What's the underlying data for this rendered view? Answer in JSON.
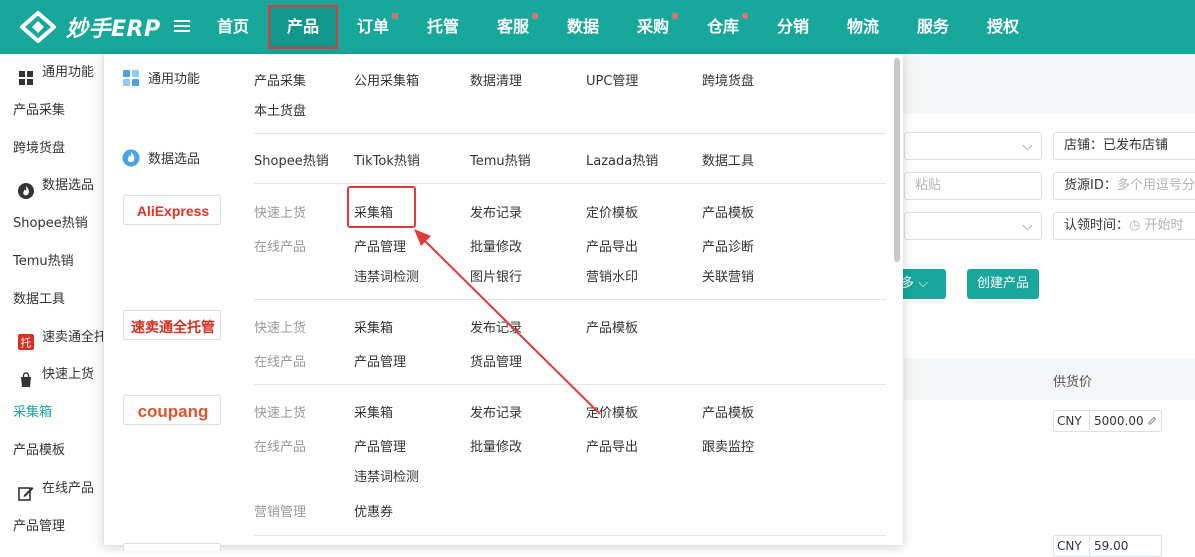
{
  "app": {
    "name": "妙手ERP"
  },
  "nav": [
    {
      "label": "首页",
      "dot": false
    },
    {
      "label": "产品",
      "dot": false,
      "active": true
    },
    {
      "label": "订单",
      "dot": true
    },
    {
      "label": "托管",
      "dot": false
    },
    {
      "label": "客服",
      "dot": true
    },
    {
      "label": "数据",
      "dot": false
    },
    {
      "label": "采购",
      "dot": true
    },
    {
      "label": "仓库",
      "dot": true
    },
    {
      "label": "分销",
      "dot": false
    },
    {
      "label": "物流",
      "dot": false
    },
    {
      "label": "服务",
      "dot": false
    },
    {
      "label": "授权",
      "dot": false
    }
  ],
  "sidebar": {
    "items": [
      {
        "label": "通用功能",
        "group": true,
        "icon": "grid-icon"
      },
      {
        "label": "产品采集"
      },
      {
        "label": "跨境货盘"
      },
      {
        "label": "数据选品",
        "group": true,
        "icon": "flame-icon"
      },
      {
        "label": "Shopee热销"
      },
      {
        "label": "Temu热销"
      },
      {
        "label": "数据工具"
      },
      {
        "label": "速卖通全托管",
        "group": true,
        "icon": "tuo-icon"
      },
      {
        "label": "快速上货",
        "group": true,
        "icon": "bag-icon"
      },
      {
        "label": "采集箱",
        "active": true
      },
      {
        "label": "产品模板"
      },
      {
        "label": "在线产品",
        "group": true,
        "icon": "edit-icon"
      },
      {
        "label": "产品管理"
      }
    ]
  },
  "background": {
    "store_select": "店铺：已发布店铺",
    "paste_hint": "粘贴",
    "source_id_label": "货源ID：",
    "source_id_placeholder": "多个用逗号分",
    "claim_time_label": "认领时间：",
    "claim_time_placeholder": "开始时",
    "more_button": "更多",
    "create_button": "创建产品",
    "supply_price_header": "供货价",
    "prices": [
      {
        "currency": "CNY",
        "amount": "5000.00"
      },
      {
        "currency": "CNY",
        "amount": "59.00"
      }
    ]
  },
  "mega_menu": {
    "general": {
      "title": "通用功能",
      "links": [
        "产品采集",
        "公用采集箱",
        "数据清理",
        "UPC管理",
        "跨境货盘",
        "本土货盘"
      ]
    },
    "data_select": {
      "title": "数据选品",
      "links": [
        "Shopee热销",
        "TikTok热销",
        "Temu热销",
        "Lazada热销",
        "数据工具"
      ]
    },
    "aliexpress": {
      "logo": "AliExpress",
      "quick_label": "快速上货",
      "quick_links": [
        "采集箱",
        "发布记录",
        "定价模板",
        "产品模板"
      ],
      "online_label": "在线产品",
      "online_links": [
        "产品管理",
        "批量修改",
        "产品导出",
        "产品诊断",
        "违禁词检测",
        "图片银行",
        "营销水印",
        "关联营销"
      ]
    },
    "aliexpress_managed": {
      "logo": "速卖通全托管",
      "quick_label": "快速上货",
      "quick_links": [
        "采集箱",
        "发布记录",
        "产品模板"
      ],
      "online_label": "在线产品",
      "online_links": [
        "产品管理",
        "货品管理"
      ]
    },
    "coupang": {
      "logo": "coupang",
      "quick_label": "快速上货",
      "quick_links": [
        "采集箱",
        "发布记录",
        "定价模板",
        "产品模板"
      ],
      "online_label": "在线产品",
      "online_links": [
        "产品管理",
        "批量修改",
        "产品导出",
        "跟卖监控",
        "违禁词检测"
      ],
      "marketing_label": "营销管理",
      "marketing_links": [
        "优惠券"
      ]
    }
  },
  "colors": {
    "brand": "#17a79b",
    "highlight": "#e23a3a"
  }
}
